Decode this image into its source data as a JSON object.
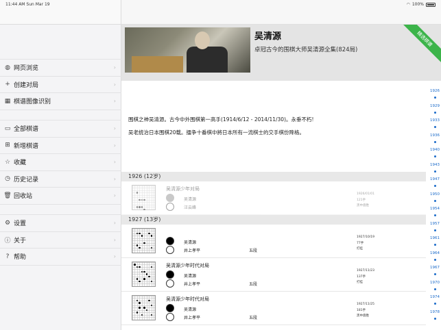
{
  "status": {
    "time": "11:44 AM",
    "date": "Sun Mar 19",
    "battery": "100%"
  },
  "sidebar": {
    "groups": [
      [
        {
          "icon": "globe-icon",
          "glyph": "◍",
          "label": "网页浏览"
        },
        {
          "icon": "plus-icon",
          "glyph": "+",
          "label": "创建对局"
        },
        {
          "icon": "grid-icon",
          "glyph": "▦",
          "label": "棋谱图像识别"
        }
      ],
      [
        {
          "icon": "folder-icon",
          "glyph": "▭",
          "label": "全部棋谱"
        },
        {
          "icon": "add-record-icon",
          "glyph": "⊞",
          "label": "新增棋谱"
        },
        {
          "icon": "star-icon",
          "glyph": "☆",
          "label": "收藏"
        },
        {
          "icon": "clock-icon",
          "glyph": "◷",
          "label": "历史记录"
        },
        {
          "icon": "trash-icon",
          "glyph": "🗑",
          "label": "回收站"
        }
      ],
      [
        {
          "icon": "gear-icon",
          "glyph": "⚙",
          "label": "设置"
        },
        {
          "icon": "info-icon",
          "glyph": "ⓘ",
          "label": "关于"
        },
        {
          "icon": "help-icon",
          "glyph": "?",
          "label": "帮助"
        }
      ]
    ]
  },
  "header": {
    "title": "吴清源",
    "subtitle": "卓冠古今的围棋大师吴清源全集(824局)",
    "ribbon": "精选棋谱"
  },
  "intro": {
    "line1": "围棋之神吴清源。古今中外围棋第一高手(1914/6/12 - 2014/11/30)。永垂不朽!",
    "line2": "吴老统治日本围棋20载。擂争十番棋中將日本所有一流棋士的交手棋份降格。"
  },
  "years": [
    "1926",
    "1929",
    "1933",
    "1936",
    "1940",
    "1943",
    "1947",
    "1950",
    "1954",
    "1957",
    "1961",
    "1964",
    "1967",
    "1970",
    "1974",
    "1978"
  ],
  "sections": [
    {
      "heading": "1926 (12岁)",
      "games": [
        {
          "title": "吴清源少年对局",
          "black": "吴清源",
          "white": "汪云峰",
          "rank": "",
          "date": "1926/01/01",
          "moves": "121手",
          "result": "黑中盘胜",
          "faded": true,
          "stones": [
            [
              3,
              6
            ],
            [
              4,
              6
            ],
            [
              5,
              6
            ],
            [
              2,
              9
            ],
            [
              3,
              9
            ],
            [
              4,
              9
            ],
            [
              5,
              10
            ],
            [
              2,
              3
            ]
          ]
        }
      ]
    },
    {
      "heading": "1927 (13岁)",
      "games": [
        {
          "title": "",
          "black": "吴清源",
          "white": "井上孝平",
          "rank": "五段",
          "date": "1927/10/19",
          "moves": "77手",
          "result": "打挂",
          "faded": false,
          "stones": [
            [
              2,
              2
            ],
            [
              3,
              2
            ],
            [
              4,
              3
            ],
            [
              7,
              2
            ],
            [
              8,
              3
            ],
            [
              2,
              7
            ],
            [
              3,
              8
            ],
            [
              8,
              8
            ],
            [
              5,
              6
            ]
          ]
        },
        {
          "title": "吴清源少年时代对局",
          "black": "吴清源",
          "white": "井上孝平",
          "rank": "五段",
          "date": "1927/11/23",
          "moves": "137手",
          "result": "打挂",
          "faded": false,
          "stones": [
            [
              1,
              1
            ],
            [
              2,
              2
            ],
            [
              3,
              2
            ],
            [
              4,
              4
            ],
            [
              5,
              4
            ],
            [
              6,
              5
            ],
            [
              7,
              6
            ],
            [
              2,
              7
            ],
            [
              3,
              8
            ],
            [
              8,
              2
            ],
            [
              8,
              8
            ],
            [
              5,
              7
            ]
          ]
        },
        {
          "title": "吴清源少年时代对局",
          "black": "吴清源",
          "white": "井上孝平",
          "rank": "五段",
          "date": "1927/11/25",
          "moves": "181手",
          "result": "黑中盘胜",
          "faded": false,
          "stones": [
            [
              2,
              2
            ],
            [
              3,
              3
            ],
            [
              7,
              2
            ],
            [
              8,
              4
            ],
            [
              2,
              7
            ],
            [
              4,
              8
            ],
            [
              6,
              6
            ],
            [
              8,
              8
            ],
            [
              5,
              5
            ],
            [
              3,
              5
            ]
          ]
        }
      ]
    }
  ]
}
